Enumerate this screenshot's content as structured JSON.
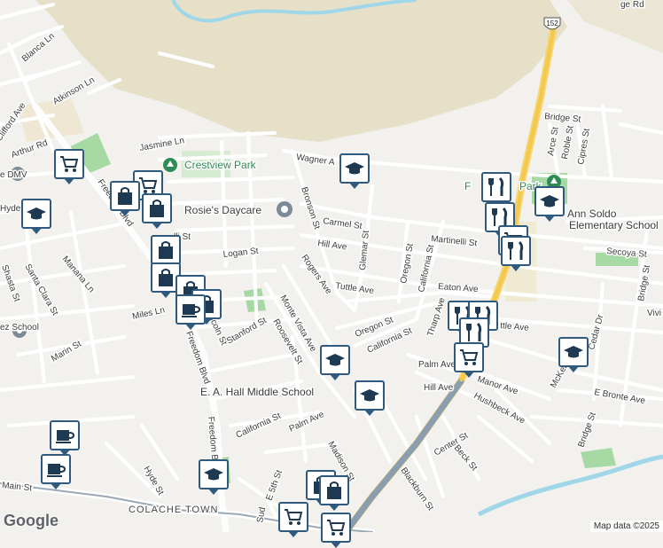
{
  "map": {
    "attribution": "Map data ©2025",
    "logo": "Google",
    "highway_shield": "152",
    "labels": {
      "ridge_rd": "ge Rd",
      "blanca_ln": "Blanca Ln",
      "atkinson_ln": "Atkinson Ln",
      "arthur_rd": "Arthur Rd",
      "clifford_ave": "Clifford Ave",
      "dmv": "e DMV",
      "hyde_school": "Hyde School",
      "jasmine_ln": "Jasmine Ln",
      "crestview_park": "Crestview Park",
      "wagner_ave": "Wagner A",
      "freedom_blvd_n": "Freedom Blvd",
      "rosies_daycare": "Rosie's Daycare",
      "bronson_st": "Bronson St",
      "carmel_st": "Carmel St",
      "hill_ave_n": "Hill Ave",
      "glemar_st": "Glemar St",
      "oregon_st_n": "Oregon St",
      "california_st_n": "California St",
      "martinelli_st": "Martinelli St",
      "lli_st": "lli St",
      "logan_st": "Logan St",
      "rogers_ave": "Rogers Ave",
      "tuttle_ave": "Tuttle Ave",
      "eaton_ave": "Eaton Ave",
      "santa_clara_st": "Santa Clara St",
      "manana_ln": "Manana Ln",
      "miles_ln": "Miles Ln",
      "lincoln_st": "Lincoln St",
      "stanford_st": "Stanford St",
      "monte_vista_ave": "Monte Vista Ave",
      "roosevelt_st": "Roosevelt St",
      "oregon_st_s": "Oregon St",
      "california_st_m": "California St",
      "thorp_ave": "Tharp Ave",
      "marin_st": "Marin St",
      "shasta_st": "Shasta St",
      "ez_school": "ez School",
      "freedom_blvd_s": "Freedom Blvd",
      "ea_hall": "E. A. Hall Middle School",
      "palm_ave_e": "Palm Ave",
      "hill_ave_s": "Hill Ave",
      "manor_ave": "Manor Ave",
      "hushbeck_ave": "Hushbeck Ave",
      "tuttle_ave_e": "ttle Ave",
      "california_st_s": "California St",
      "palm_ave_w": "Palm Ave",
      "madison_st": "Madison St",
      "center_st": "Center St",
      "beck_st": "Beck St",
      "blackburn_st": "Blackburn St",
      "hyde_st": "Hyde St",
      "main_st": "Main St",
      "colache_town": "COLACHE TOWN",
      "fifth_st": "E 5th St",
      "sudden_st": "Sud",
      "freedom_blvd_ss": "Freedom Blvd",
      "bridge_st_n": "Bridge St",
      "arce_st": "Arce St",
      "roble_st": "Roble St",
      "cipres_st": "Cipres St",
      "fpark": "F",
      "park": "Park",
      "ann_soldo": "Ann Soldo",
      "elementary": "Elementary School",
      "secoya_st": "Secoya St",
      "bridge_st_e": "Bridge St",
      "vivi": "Vivi",
      "cedar_dr": "Cedar Dr",
      "mckenzie": "McKenzie",
      "e_bronte_ave": "E Bronte Ave",
      "bridge_st_s": "Bridge St"
    }
  }
}
